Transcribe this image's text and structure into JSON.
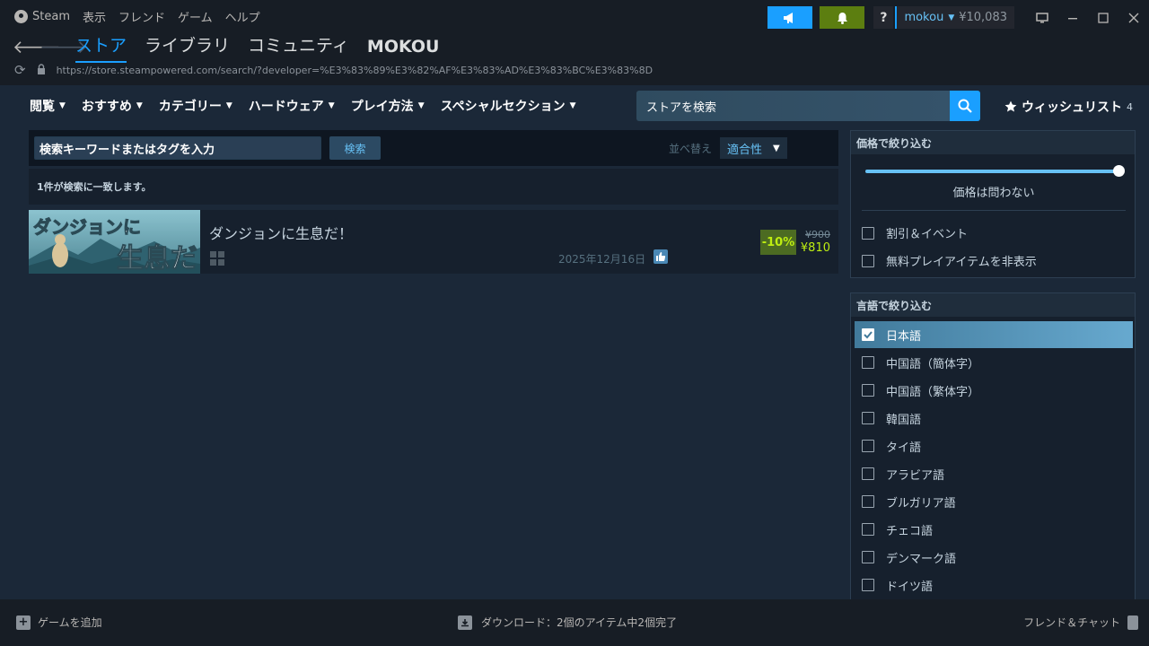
{
  "menu": {
    "app": "Steam",
    "items": [
      "表示",
      "フレンド",
      "ゲーム",
      "ヘルプ"
    ]
  },
  "account": {
    "help": "?",
    "name": "mokou",
    "balance": "¥10,083"
  },
  "nav": {
    "tabs": [
      "ストア",
      "ライブラリ",
      "コミュニティ",
      "MOKOU"
    ]
  },
  "url": "https://store.steampowered.com/search/?developer=%E3%83%89%E3%82%AF%E3%83%AD%E3%83%BC%E3%83%8D",
  "storenav": {
    "items": [
      "閲覧",
      "おすすめ",
      "カテゴリー",
      "ハードウェア",
      "プレイ方法",
      "スペシャルセクション"
    ],
    "search_placeholder": "ストアを検索",
    "wishlist_label": "ウィッシュリスト",
    "wishlist_count": "4"
  },
  "search": {
    "keyword_placeholder": "検索キーワードまたはタグを入力",
    "search_button": "検索",
    "sort_label": "並べ替え",
    "sort_value": "適合性",
    "match_text": "1件が検索に一致します。"
  },
  "results": [
    {
      "title": "ダンジョンに生息だ！",
      "date": "2025年12月16日",
      "discount": "-10%",
      "original_price": "¥900",
      "final_price": "¥810",
      "capsule_text_top": "ダンジョンに",
      "capsule_text_bottom": "生息だ!"
    }
  ],
  "filters": {
    "price": {
      "header": "価格で絞り込む",
      "value_label": "価格は問わない",
      "slider_fraction": 1.0,
      "options": [
        "割引＆イベント",
        "無料プレイアイテムを非表示"
      ]
    },
    "language": {
      "header": "言語で絞り込む",
      "options": [
        "日本語",
        "中国語（簡体字）",
        "中国語（繁体字）",
        "韓国語",
        "タイ語",
        "アラビア語",
        "ブルガリア語",
        "チェコ語",
        "デンマーク語",
        "ドイツ語"
      ],
      "selected": "日本語"
    }
  },
  "bottombar": {
    "add_game": "ゲームを追加",
    "download_status": "ダウンロード：2個のアイテム中2個完了",
    "friends_chat": "フレンド＆チャット"
  },
  "colors": {
    "accent": "#1a9fff",
    "discount_bg": "#4c6b22",
    "discount_text": "#beee11",
    "background": "#1b2838"
  }
}
